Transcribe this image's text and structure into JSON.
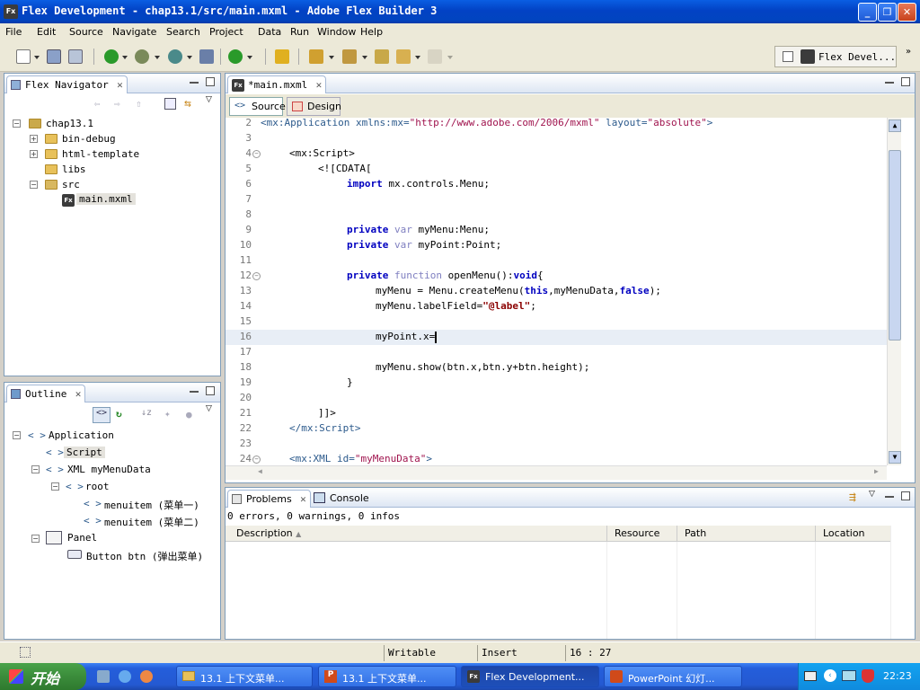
{
  "window": {
    "title": "Flex Development - chap13.1/src/main.mxml - Adobe Flex Builder 3",
    "logo": "Fx"
  },
  "menu": [
    "File",
    "Edit",
    "Source",
    "Navigate",
    "Search",
    "Project",
    "Data",
    "Run",
    "Window",
    "Help"
  ],
  "perspective": {
    "label": "Flex Devel..."
  },
  "navigator": {
    "title": "Flex Navigator",
    "items": [
      {
        "label": "chap13.1"
      },
      {
        "label": "bin-debug"
      },
      {
        "label": "html-template"
      },
      {
        "label": "libs"
      },
      {
        "label": "src"
      },
      {
        "label": "main.mxml"
      }
    ]
  },
  "outline": {
    "title": "Outline",
    "items": [
      {
        "label": "Application"
      },
      {
        "label": "Script"
      },
      {
        "label": "XML myMenuData"
      },
      {
        "label": "root"
      },
      {
        "label": "menuitem (菜单一)"
      },
      {
        "label": "menuitem (菜单二)"
      },
      {
        "label": "Panel"
      },
      {
        "label": "Button btn (弹出菜单)"
      }
    ]
  },
  "editor": {
    "tab": "*main.mxml",
    "source_tab": "Source",
    "design_tab": "Design",
    "lines": [
      "2",
      "3",
      "4",
      "5",
      "6",
      "7",
      "8",
      "9",
      "10",
      "11",
      "12",
      "13",
      "14",
      "15",
      "16",
      "17",
      "18",
      "19",
      "20",
      "21",
      "22",
      "23",
      "24"
    ]
  },
  "code": {
    "l2a": "<mx:Application",
    "l2b": " xmlns:mx=",
    "l2c": "\"http://www.adobe.com/2006/mxml\"",
    "l2d": " layout=",
    "l2e": "\"absolute\"",
    "l2f": ">",
    "l4": "<mx:Script>",
    "l5": "<![CDATA[",
    "l6a": "import",
    "l6b": " mx.controls.Menu;",
    "l9a": "private",
    "l9b": " var",
    "l9c": " myMenu:Menu;",
    "l10a": "private",
    "l10b": " var",
    "l10c": " myPoint:Point;",
    "l12a": "private",
    "l12b": " function",
    "l12c": " openMenu():",
    "l12d": "void",
    "l12e": "{",
    "l13a": "myMenu = Menu.createMenu(",
    "l13b": "this",
    "l13c": ",myMenuData,",
    "l13d": "false",
    "l13e": ");",
    "l14a": "myMenu.labelField=",
    "l14b": "\"@label\"",
    "l14c": ";",
    "l16": "myPoint.x=",
    "l18": "myMenu.show(btn.x,btn.y+btn.height);",
    "l19": "}",
    "l21": "]]>",
    "l22": "</mx:Script>",
    "l24a": "<mx:XML",
    "l24b": " id=",
    "l24c": "\"myMenuData\"",
    "l24d": ">"
  },
  "problems": {
    "tab": "Problems",
    "console_tab": "Console",
    "summary": "0 errors, 0 warnings, 0 infos",
    "columns": [
      "Description",
      "Resource",
      "Path",
      "Location"
    ]
  },
  "status": {
    "writable": "Writable",
    "insert": "Insert",
    "position": "16 : 27"
  },
  "taskbar": {
    "start": "开始",
    "tasks": [
      "13.1 上下文菜单...",
      "13.1 上下文菜单...",
      "Flex Development...",
      "PowerPoint 幻灯..."
    ],
    "time": "22:23"
  }
}
